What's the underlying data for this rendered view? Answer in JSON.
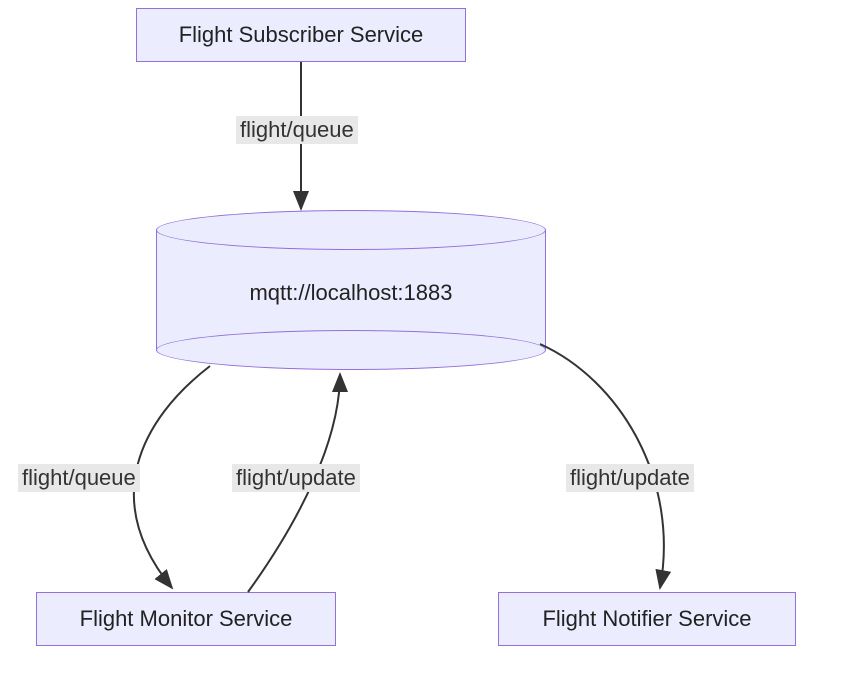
{
  "nodes": {
    "subscriber": {
      "label": "Flight Subscriber Service"
    },
    "broker": {
      "label": "mqtt://localhost:1883"
    },
    "monitor": {
      "label": "Flight Monitor Service"
    },
    "notifier": {
      "label": "Flight Notifier Service"
    }
  },
  "edges": {
    "sub_to_broker": {
      "label": "flight/queue"
    },
    "broker_to_monitor": {
      "label": "flight/queue"
    },
    "monitor_to_broker": {
      "label": "flight/update"
    },
    "broker_to_notifier": {
      "label": "flight/update"
    }
  },
  "colors": {
    "node_fill": "#ECECFF",
    "node_border": "#9370DB",
    "label_bg": "#e8e8e8",
    "arrow": "#333333"
  }
}
